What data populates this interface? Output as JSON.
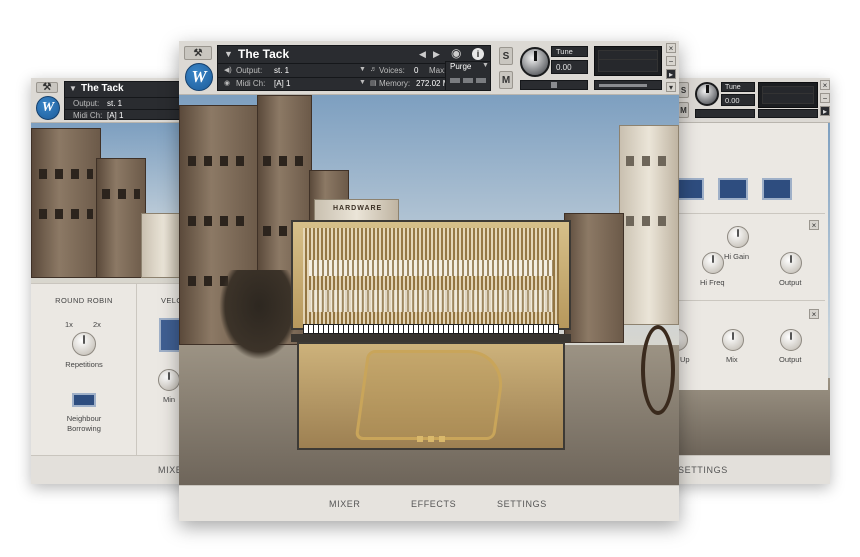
{
  "left_window": {
    "instrument_name": "The Tack",
    "output_label": "Output:",
    "output_value": "st. 1",
    "midi_label": "Midi Ch:",
    "midi_value": "[A] 1",
    "logo_letter": "W",
    "round_robin": {
      "title": "ROUND ROBIN",
      "opt_1x": "1x",
      "opt_2x": "2x",
      "repetitions_label": "Repetitions",
      "neighbour_label_line1": "Neighbour",
      "neighbour_label_line2": "Borrowing"
    },
    "velocity_title": "VELO",
    "min_label": "Min",
    "tab_mixer": "MIXER"
  },
  "center_window": {
    "instrument_name": "The Tack",
    "output_label": "Output:",
    "output_value": "st. 1",
    "midi_label": "Midi Ch:",
    "midi_value": "[A] 1",
    "voices_label": "Voices:",
    "voices_value": "0",
    "max_label": "Max:",
    "max_value": "2048",
    "memory_label": "Memory:",
    "memory_value": "272.02 MB",
    "purge_label": "Purge",
    "tune_label": "Tune",
    "tune_value": "0.00",
    "solo_label": "S",
    "mute_label": "M",
    "logo_letter": "W",
    "info_icon_char": "i",
    "tabs": {
      "mixer": "MIXER",
      "effects": "EFFECTS",
      "settings": "SETTINGS"
    },
    "saloon_sign": "HARDWARE"
  },
  "right_window": {
    "tune_label": "Tune",
    "tune_value": "0.00",
    "solo_label": "S",
    "mute_label": "M",
    "effects_top": {
      "hi_gain_label": "Hi Gain",
      "hi_freq_label": "Hi Freq",
      "output_label": "Output"
    },
    "effects_bottom": {
      "up_label": "Up",
      "mix_label": "Mix",
      "output_label": "Output"
    },
    "tab_settings": "SETTINGS"
  },
  "colors": {
    "accent_blue": "#2e4d7f",
    "header_dark": "#2a2c30",
    "panel_bg": "#ece9e4"
  }
}
